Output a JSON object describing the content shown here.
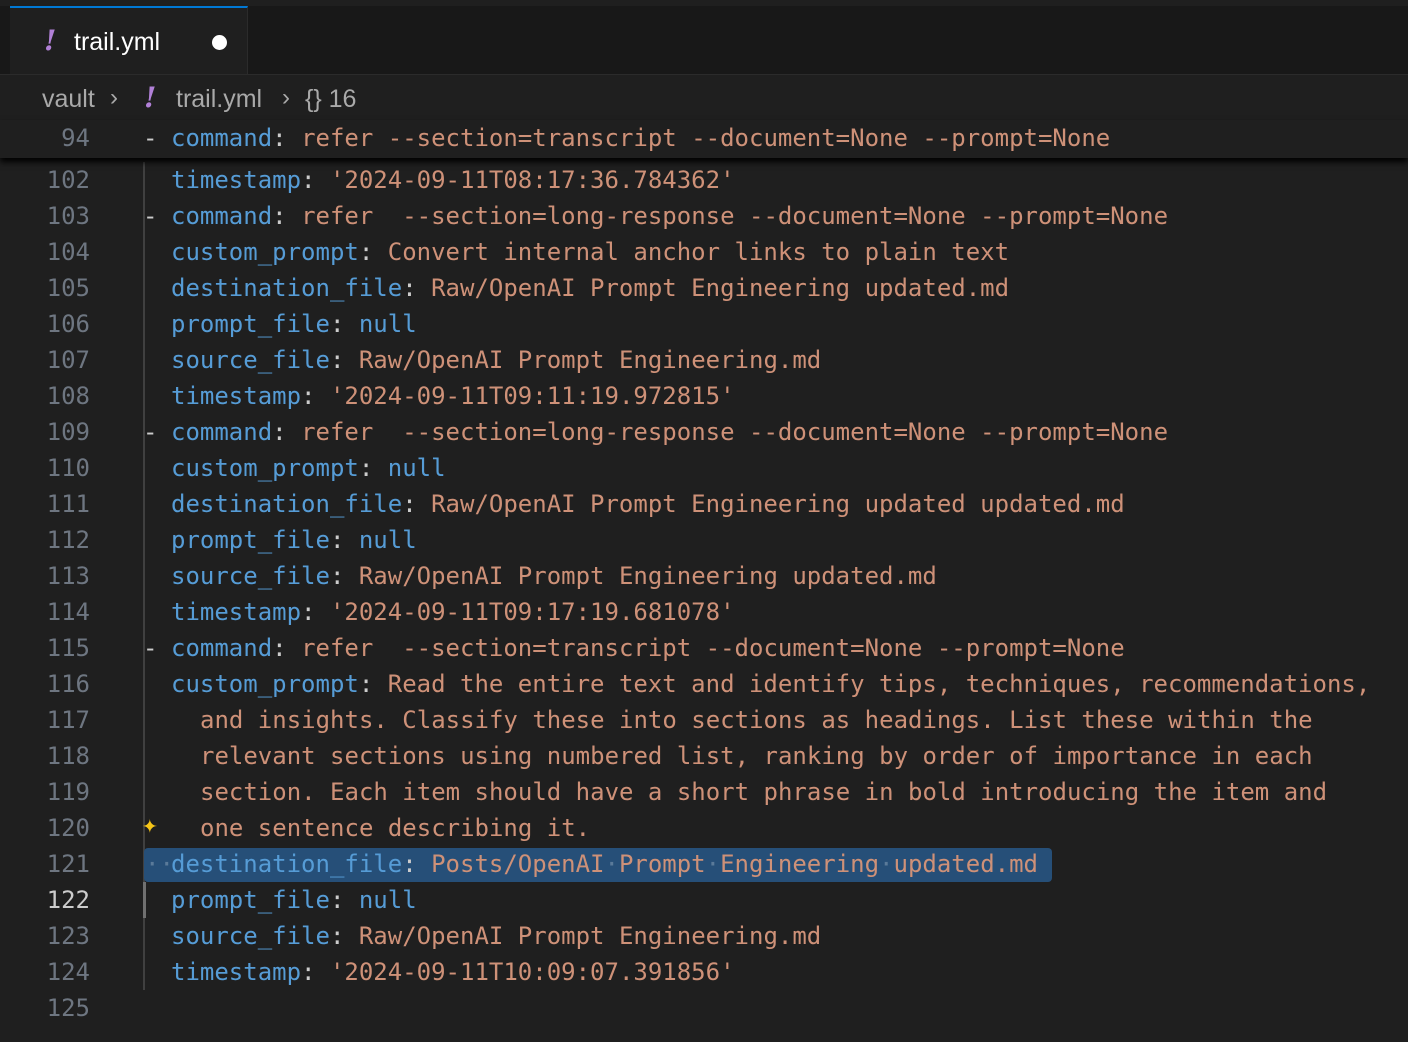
{
  "tab": {
    "title": "trail.yml",
    "icon": "yaml-exclamation-icon"
  },
  "breadcrumb": {
    "folder": "vault",
    "file": "trail.yml",
    "symbol": "{} 16"
  },
  "colors": {
    "key": "#569cd6",
    "string": "#ce9178",
    "punct": "#cccccc",
    "selection": "#264f78",
    "accent": "#0078d4"
  },
  "sticky": {
    "num": "94",
    "key": "command",
    "value": "refer  --section=transcript --document=None --prompt=None"
  },
  "lines": [
    {
      "num": "102",
      "key": "timestamp",
      "value": "'2024-09-11T08:17:36.784362'"
    },
    {
      "num": "103",
      "dash": true,
      "key": "command",
      "value": "refer  --section=long-response --document=None --prompt=None"
    },
    {
      "num": "104",
      "key": "custom_prompt",
      "value": "Convert internal anchor links to plain text"
    },
    {
      "num": "105",
      "key": "destination_file",
      "value": "Raw/OpenAI Prompt Engineering updated.md"
    },
    {
      "num": "106",
      "key": "prompt_file",
      "value": "null",
      "valueKey": true
    },
    {
      "num": "107",
      "key": "source_file",
      "value": "Raw/OpenAI Prompt Engineering.md"
    },
    {
      "num": "108",
      "key": "timestamp",
      "value": "'2024-09-11T09:11:19.972815'"
    },
    {
      "num": "109",
      "dash": true,
      "key": "command",
      "value": "refer  --section=long-response --document=None --prompt=None"
    },
    {
      "num": "110",
      "key": "custom_prompt",
      "value": "null",
      "valueKey": true
    },
    {
      "num": "111",
      "key": "destination_file",
      "value": "Raw/OpenAI Prompt Engineering updated updated.md"
    },
    {
      "num": "112",
      "key": "prompt_file",
      "value": "null",
      "valueKey": true
    },
    {
      "num": "113",
      "key": "source_file",
      "value": "Raw/OpenAI Prompt Engineering updated.md"
    },
    {
      "num": "114",
      "key": "timestamp",
      "value": "'2024-09-11T09:17:19.681078'"
    },
    {
      "num": "115",
      "dash": true,
      "key": "command",
      "value": "refer  --section=transcript --document=None --prompt=None"
    },
    {
      "num": "116",
      "key": "custom_prompt",
      "value": "Read the entire text and identify tips, techniques, recommendations,"
    },
    {
      "num": "117",
      "cont": "and insights. Classify these into sections as headings. List these within the"
    },
    {
      "num": "118",
      "cont": "relevant sections using numbered list, ranking by order of importance in each"
    },
    {
      "num": "119",
      "cont": "section. Each item should have a short phrase in bold introducing the item and"
    },
    {
      "num": "120",
      "cont": "one sentence describing it."
    },
    {
      "num": "121",
      "key": "destination_file",
      "value": "Posts/OpenAI Prompt Engineering updated.md",
      "selected": true
    },
    {
      "num": "122",
      "key": "prompt_file",
      "value": "null",
      "valueKey": true,
      "active": true
    },
    {
      "num": "123",
      "key": "source_file",
      "value": "Raw/OpenAI Prompt Engineering.md"
    },
    {
      "num": "124",
      "key": "timestamp",
      "value": "'2024-09-11T10:09:07.391856'"
    },
    {
      "num": "125",
      "empty": true
    }
  ]
}
